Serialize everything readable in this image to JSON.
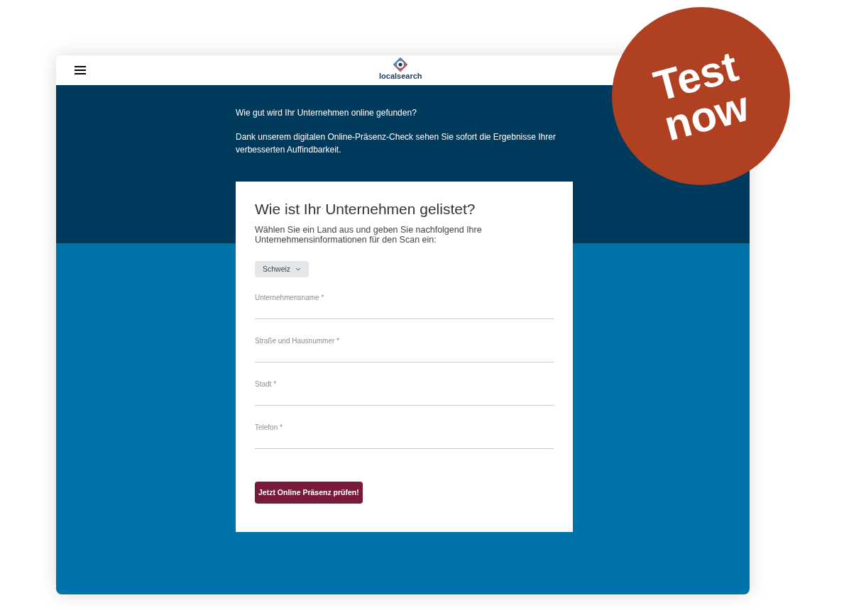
{
  "header": {
    "logo_text": "localsearch"
  },
  "intro": {
    "question": "Wie gut wird Ihr Unternehmen online gefunden?",
    "text": "Dank unserem digitalen Online-Präsenz-Check sehen Sie sofort die Ergebnisse Ihrer verbesserten Auffindbarkeit."
  },
  "form": {
    "title": "Wie ist Ihr Unternehmen gelistet?",
    "subtitle": "Wählen Sie ein Land aus und geben Sie nachfolgend Ihre Unternehmensinformationen für den Scan ein:",
    "country": "Schweiz",
    "fields": [
      {
        "placeholder": "Unternehmensname *"
      },
      {
        "placeholder": "Straße und Hausnummer *"
      },
      {
        "placeholder": "Stadt *"
      },
      {
        "placeholder": "Telefon *"
      }
    ],
    "submit": "Jetzt Online Präsenz prüfen!"
  },
  "badge": {
    "lines": [
      "Test",
      "now"
    ]
  }
}
